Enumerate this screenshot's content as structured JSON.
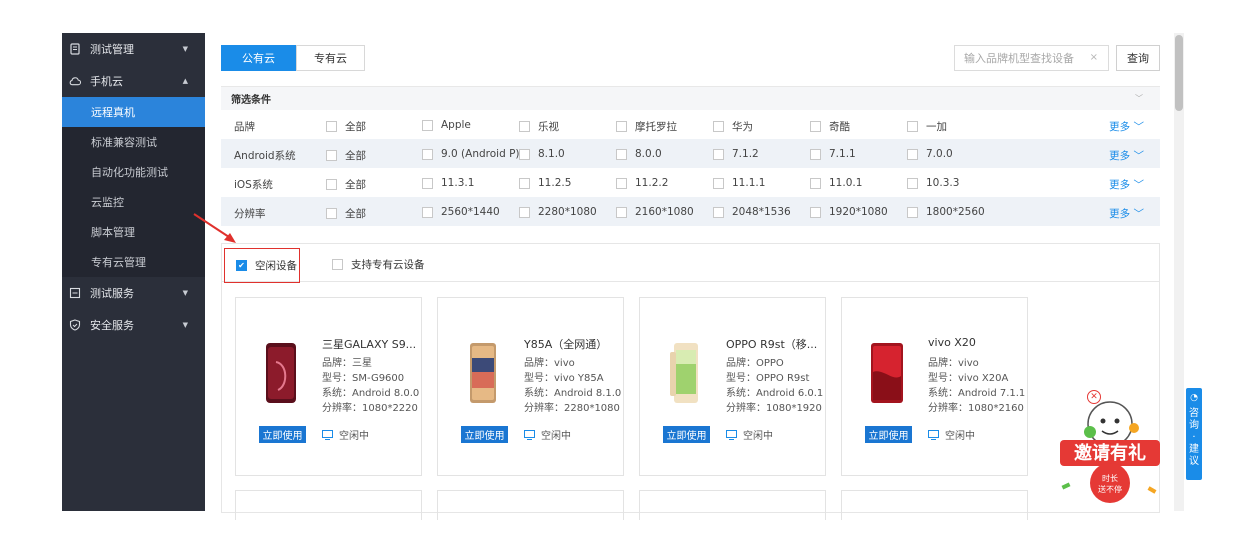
{
  "sidebar": {
    "groups": [
      {
        "label": "测试管理",
        "icon": "document-icon"
      },
      {
        "label": "手机云",
        "icon": "cloud-icon"
      }
    ],
    "sub_items": [
      "远程真机",
      "标准兼容测试",
      "自动化功能测试",
      "云监控",
      "脚本管理",
      "专有云管理"
    ],
    "groups_after": [
      {
        "label": "测试服务",
        "icon": "server-icon"
      },
      {
        "label": "安全服务",
        "icon": "shield-icon"
      }
    ]
  },
  "tabs": {
    "public": "公有云",
    "private": "专有云"
  },
  "search": {
    "placeholder": "输入品牌机型查找设备",
    "clear": "×",
    "button": "查询"
  },
  "filter": {
    "title": "筛选条件",
    "more": "更多",
    "rows": [
      {
        "label": "品牌",
        "options": [
          "全部",
          "Apple",
          "乐视",
          "摩托罗拉",
          "华为",
          "奇酷",
          "一加"
        ]
      },
      {
        "label": "Android系统",
        "options": [
          "全部",
          "9.0 (Android P)",
          "8.1.0",
          "8.0.0",
          "7.1.2",
          "7.1.1",
          "7.0.0"
        ]
      },
      {
        "label": "iOS系统",
        "options": [
          "全部",
          "11.3.1",
          "11.2.5",
          "11.2.2",
          "11.1.1",
          "11.0.1",
          "10.3.3"
        ]
      },
      {
        "label": "分辨率",
        "options": [
          "全部",
          "2560*1440",
          "2280*1080",
          "2160*1080",
          "2048*1536",
          "1920*1080",
          "1800*2560"
        ]
      }
    ]
  },
  "checks": {
    "idle": "空闲设备",
    "private_support": "支持专有云设备"
  },
  "devices": [
    {
      "name": "三星GALAXY S9...",
      "brand": "品牌：三星",
      "model": "型号：SM-G9600",
      "system": "系统：Android 8.0.0",
      "resolution": "分辨率：1080*2220",
      "button": "立即使用",
      "status": "空闲中",
      "color": "#8c1b2b"
    },
    {
      "name": "Y85A（全网通）",
      "brand": "品牌：vivo",
      "model": "型号：vivo Y85A",
      "system": "系统：Android 8.1.0",
      "resolution": "分辨率：2280*1080",
      "button": "立即使用",
      "status": "空闲中",
      "color": "#d9b389"
    },
    {
      "name": "OPPO R9st（移...",
      "brand": "品牌：OPPO",
      "model": "型号：OPPO R9st",
      "system": "系统：Android 6.0.1",
      "resolution": "分辨率：1080*1920",
      "button": "立即使用",
      "status": "空闲中",
      "color": "#e8cfa2"
    },
    {
      "name": "vivo X20",
      "brand": "品牌：vivo",
      "model": "型号：vivo X20A",
      "system": "系统：Android 7.1.1",
      "resolution": "分辨率：1080*2160",
      "button": "立即使用",
      "status": "空闲中",
      "color": "#c8202a"
    }
  ],
  "consult": [
    "咨",
    "询",
    "·",
    "建",
    "议"
  ],
  "invite": {
    "title": "邀请有礼",
    "line1": "时长",
    "line2": "送不停"
  }
}
